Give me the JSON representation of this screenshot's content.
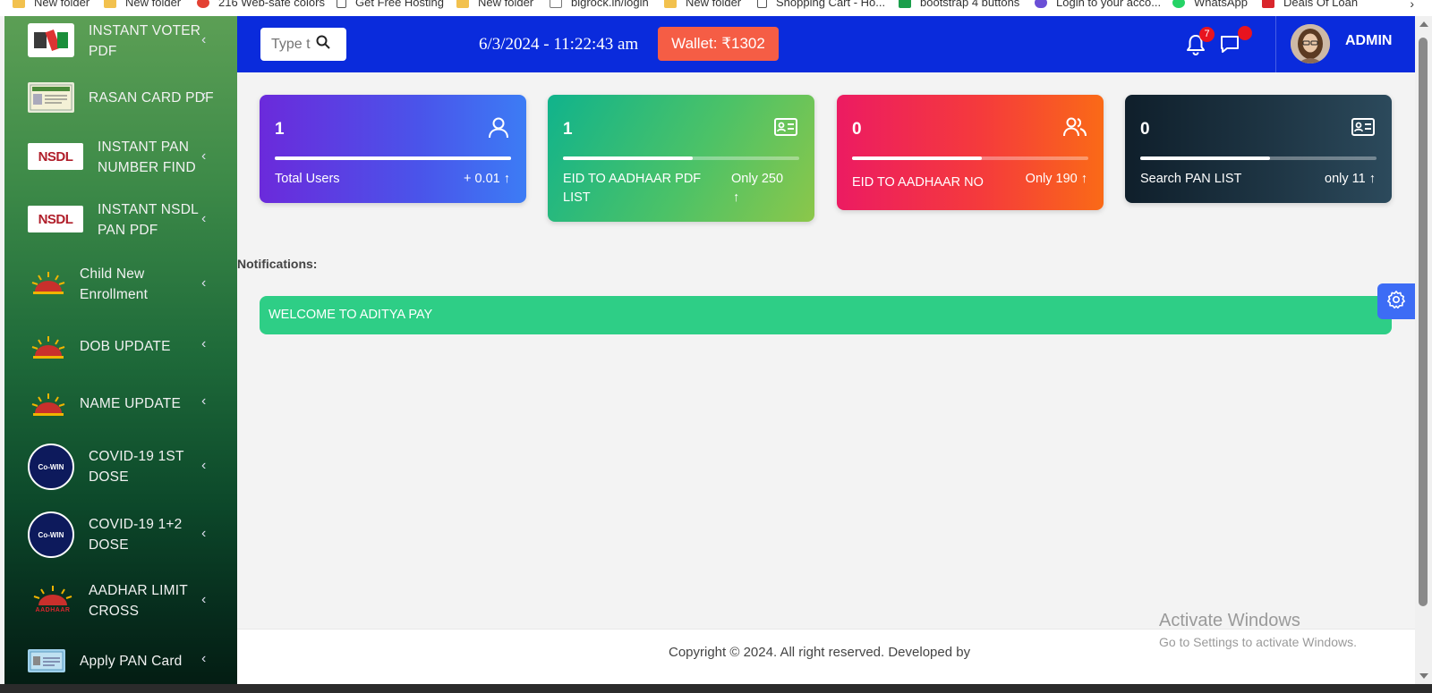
{
  "bookmarks": [
    {
      "label": "New folder",
      "icon": "folder-icon",
      "color": "#f2c14e"
    },
    {
      "label": "New folder",
      "icon": "folder-icon",
      "color": "#f2c14e"
    },
    {
      "label": "216 Web-safe colors",
      "icon": "chrome-icon",
      "color": "#e34133"
    },
    {
      "label": "Get Free Hosting",
      "icon": "page-icon",
      "color": "#555555"
    },
    {
      "label": "New folder",
      "icon": "folder-icon",
      "color": "#f2c14e"
    },
    {
      "label": "bigrock.in/login",
      "icon": "link-icon",
      "color": "#777777"
    },
    {
      "label": "New folder",
      "icon": "folder-icon",
      "color": "#f2c14e"
    },
    {
      "label": "Shopping Cart - Ho...",
      "icon": "page-icon",
      "color": "#555555"
    },
    {
      "label": "bootstrap 4 buttons",
      "icon": "w-icon",
      "color": "#1a9e4b"
    },
    {
      "label": "Login to your acco...",
      "icon": "infinity-icon",
      "color": "#6a4fd6"
    },
    {
      "label": "WhatsApp",
      "icon": "whatsapp-icon",
      "color": "#25d366"
    },
    {
      "label": "Deals Of Loan",
      "icon": "d-icon",
      "color": "#d9262c"
    }
  ],
  "sidebar": {
    "items": [
      {
        "label1": "INSTANT VOTER",
        "label2": "PDF",
        "icon": "voter-icon"
      },
      {
        "label1": "RASAN CARD PDF",
        "label2": "",
        "icon": "ration-card-icon"
      },
      {
        "label1": "INSTANT PAN",
        "label2": "NUMBER FIND",
        "icon": "nsdl-logo-icon",
        "logo_text": "NSDL"
      },
      {
        "label1": "INSTANT NSDL",
        "label2": "PAN PDF",
        "icon": "nsdl-logo-icon",
        "logo_text": "NSDL"
      },
      {
        "label1": "Child New",
        "label2": "Enrollment",
        "icon": "aadhaar-sun-icon"
      },
      {
        "label1": "DOB UPDATE",
        "label2": "",
        "icon": "aadhaar-sun-icon"
      },
      {
        "label1": "NAME UPDATE",
        "label2": "",
        "icon": "aadhaar-sun-icon"
      },
      {
        "label1": "COVID-19 1ST",
        "label2": "DOSE",
        "icon": "cowin-icon",
        "logo_text": "Co-WIN"
      },
      {
        "label1": "COVID-19 1+2",
        "label2": "DOSE",
        "icon": "cowin-icon",
        "logo_text": "Co-WIN"
      },
      {
        "label1": "AADHAR LIMIT",
        "label2": "CROSS",
        "icon": "aadhaar-logo-icon",
        "logo_text": "AADHAAR"
      },
      {
        "label1": "Apply PAN Card",
        "label2": "",
        "icon": "pan-card-icon"
      }
    ]
  },
  "header": {
    "search_placeholder": "Type to search",
    "datetime": "6/3/2024 - 11:22:43 am",
    "wallet": "Wallet: ₹1302",
    "notification_count": "7",
    "user": "ADMIN"
  },
  "cards": [
    {
      "number": "1",
      "label1": "Total Users",
      "label2": "",
      "stat1": "+ 0.01",
      "stat2": "",
      "progress": 1.0,
      "icon": "user-icon"
    },
    {
      "number": "1",
      "label1": "EID TO AADHAAR PDF",
      "label2": "LIST",
      "stat1": "Only 250",
      "stat2": "",
      "progress": 0.55,
      "icon": "id-card-icon"
    },
    {
      "number": "0",
      "label1": "EID TO AADHAAR NO",
      "label2": "",
      "stat1": "Only 190",
      "stat2": "",
      "progress": 0.55,
      "icon": "users-icon"
    },
    {
      "number": "0",
      "label1": "Search PAN LIST",
      "label2": "",
      "stat1": "only 11",
      "stat2": "",
      "progress": 0.55,
      "icon": "id-card-icon"
    }
  ],
  "notifications": {
    "title": "Notifications:",
    "message": "WELCOME TO ADITYA PAY"
  },
  "footer": {
    "copyright": "Copyright © 2024. All right reserved. Developed by"
  },
  "watermark": {
    "line1": "Activate Windows",
    "line2": "Go to Settings to activate Windows."
  }
}
